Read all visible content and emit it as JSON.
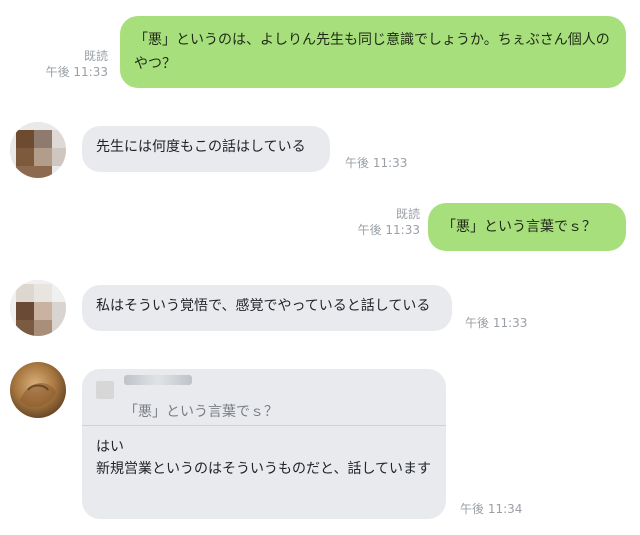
{
  "messages": [
    {
      "id": "m1",
      "direction": "out",
      "text_lines": [
        "「悪」というのは、よしりん先生も同じ意識でしょうか。ちぇぶさん個人の",
        "やつ？"
      ],
      "read_label": "既読",
      "time": "午後 11:33"
    },
    {
      "id": "m2",
      "direction": "in",
      "text": "先生には何度もこの話はしている",
      "time": "午後 11:33"
    },
    {
      "id": "m3",
      "direction": "out",
      "text": "「悪」という言葉でｓ？",
      "read_label": "既読",
      "time": "午後 11:33"
    },
    {
      "id": "m4",
      "direction": "in",
      "text": "私はそういう覚悟で、感覚でやっていると話している",
      "time": "午後 11:33"
    },
    {
      "id": "m5",
      "direction": "in",
      "reply_quote": "「悪」という言葉でｓ？",
      "text_lines": [
        "はい",
        "新規営業というのはそういうものだと、話しています"
      ],
      "time": "午後 11:34"
    }
  ],
  "colors": {
    "outgoing_bubble": "#a8df7d",
    "incoming_bubble": "#e8eaee",
    "meta_text": "#9aa0a6"
  }
}
